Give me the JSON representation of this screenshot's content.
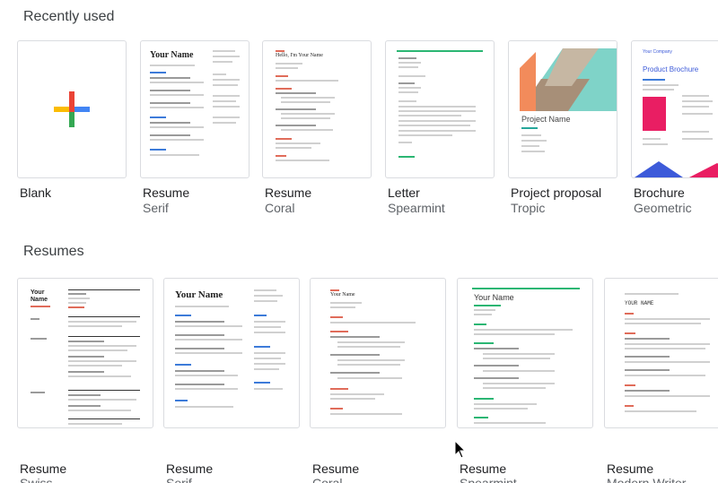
{
  "sections": {
    "recent": {
      "title": "Recently used"
    },
    "resumes": {
      "title": "Resumes"
    }
  },
  "recent": [
    {
      "title": "Blank",
      "subtitle": ""
    },
    {
      "title": "Resume",
      "subtitle": "Serif",
      "thumb_heading": "Your Name"
    },
    {
      "title": "Resume",
      "subtitle": "Coral",
      "thumb_heading": "Hello, I'm Your Name"
    },
    {
      "title": "Letter",
      "subtitle": "Spearmint"
    },
    {
      "title": "Project proposal",
      "subtitle": "Tropic",
      "thumb_heading": "Project Name"
    },
    {
      "title": "Brochure",
      "subtitle": "Geometric",
      "thumb_company": "Your Company",
      "thumb_heading": "Product Brochure"
    }
  ],
  "resumes": [
    {
      "title": "Resume",
      "subtitle": "Swiss",
      "thumb_heading": "Your Name"
    },
    {
      "title": "Resume",
      "subtitle": "Serif",
      "thumb_heading": "Your Name"
    },
    {
      "title": "Resume",
      "subtitle": "Coral",
      "thumb_heading": "Your Name"
    },
    {
      "title": "Resume",
      "subtitle": "Spearmint",
      "thumb_heading": "Your Name"
    },
    {
      "title": "Resume",
      "subtitle": "Modern Writer",
      "thumb_heading": "YOUR NAME"
    }
  ],
  "colors": {
    "plus_blue": "#4285f4",
    "plus_red": "#ea4335",
    "plus_yellow": "#fbbc04",
    "plus_green": "#34a853",
    "spearmint": "#2bb673",
    "coral": "#e06c5a",
    "tropic_teal": "#7fd3c8",
    "tropic_orange": "#f28b5b",
    "brochure_blue": "#3d5bd9",
    "brochure_pink": "#e91e63"
  }
}
